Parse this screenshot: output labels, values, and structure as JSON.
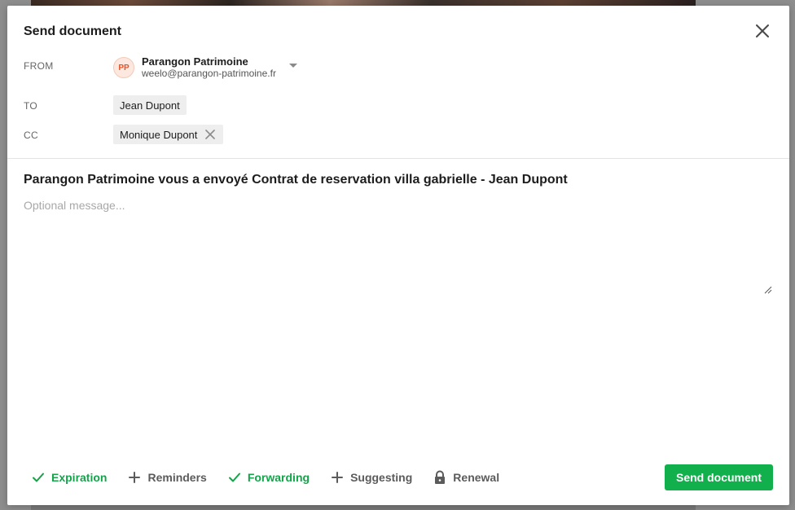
{
  "dialog": {
    "title": "Send document",
    "close_icon": "close-icon"
  },
  "from": {
    "label": "FROM",
    "avatar_initials": "PP",
    "avatar_color": "#e2552a",
    "name": "Parangon Patrimoine",
    "email": "weelo@parangon-patrimoine.fr"
  },
  "to": {
    "label": "TO",
    "recipients": [
      "Jean Dupont"
    ]
  },
  "cc": {
    "label": "CC",
    "recipients": [
      "Monique Dupont"
    ]
  },
  "message": {
    "subject": "Parangon Patrimoine vous a envoyé Contrat de reservation villa gabrielle - Jean Dupont",
    "value": "",
    "placeholder": "Optional message..."
  },
  "options": [
    {
      "label": "Expiration",
      "icon": "check-icon",
      "enabled": true
    },
    {
      "label": "Reminders",
      "icon": "plus-icon",
      "enabled": false
    },
    {
      "label": "Forwarding",
      "icon": "check-icon",
      "enabled": true
    },
    {
      "label": "Suggesting",
      "icon": "plus-icon",
      "enabled": false
    },
    {
      "label": "Renewal",
      "icon": "lock-icon",
      "enabled": false
    }
  ],
  "send_button_label": "Send document",
  "colors": {
    "accent_green": "#12b04d",
    "enabled_option": "#15a34a",
    "disabled_option": "#5b5b5b"
  }
}
